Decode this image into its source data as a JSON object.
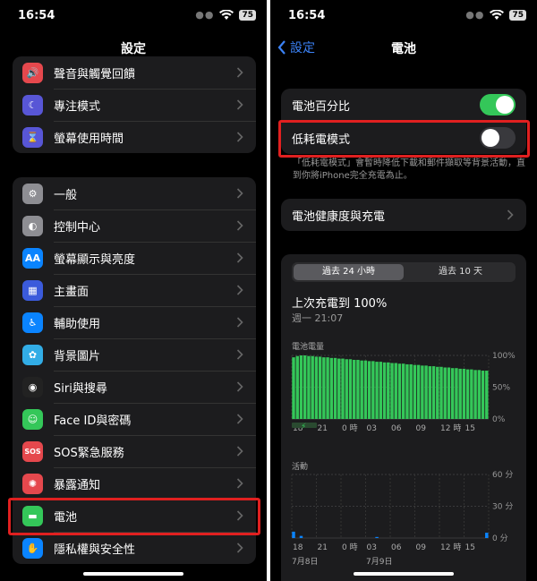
{
  "status": {
    "time": "16:54",
    "battery": "75"
  },
  "left": {
    "title": "設定",
    "group1": [
      {
        "label": "聲音與觸覺回饋",
        "icon": "speaker-icon",
        "color": "#e5484d",
        "glyph": "🔊"
      },
      {
        "label": "專注模式",
        "icon": "moon-icon",
        "color": "#5856d6",
        "glyph": "☾"
      },
      {
        "label": "螢幕使用時間",
        "icon": "hourglass-icon",
        "color": "#5856d6",
        "glyph": "⌛"
      }
    ],
    "group2": [
      {
        "label": "一般",
        "icon": "gear-icon",
        "color": "#8e8e93",
        "glyph": "⚙"
      },
      {
        "label": "控制中心",
        "icon": "switches-icon",
        "color": "#8e8e93",
        "glyph": "◐"
      },
      {
        "label": "螢幕顯示與亮度",
        "icon": "text-size-icon",
        "color": "#0a84ff",
        "glyph": "AA"
      },
      {
        "label": "主畫面",
        "icon": "grid-icon",
        "color": "#3b5bdb",
        "glyph": "▦"
      },
      {
        "label": "輔助使用",
        "icon": "accessibility-icon",
        "color": "#0a84ff",
        "glyph": "♿"
      },
      {
        "label": "背景圖片",
        "icon": "flower-icon",
        "color": "#32ade6",
        "glyph": "✿"
      },
      {
        "label": "Siri與搜尋",
        "icon": "siri-icon",
        "color": "#222",
        "glyph": "◉"
      },
      {
        "label": "Face ID與密碼",
        "icon": "face-id-icon",
        "color": "#34c759",
        "glyph": "☺"
      },
      {
        "label": "SOS緊急服務",
        "icon": "sos-icon",
        "color": "#e5484d",
        "glyph": "SOS"
      },
      {
        "label": "暴露通知",
        "icon": "exposure-icon",
        "color": "#e5484d",
        "glyph": "✺"
      },
      {
        "label": "電池",
        "icon": "battery-icon",
        "color": "#34c759",
        "glyph": "▬"
      },
      {
        "label": "隱私權與安全性",
        "icon": "hand-icon",
        "color": "#0a84ff",
        "glyph": "✋"
      }
    ]
  },
  "right": {
    "back_label": "設定",
    "title": "電池",
    "battery_percentage_label": "電池百分比",
    "low_power_label": "低耗電模式",
    "low_power_footer": "「低耗電模式」會暫時降低下載和郵件擷取等背景活動，直到你將iPhone完全充電為止。",
    "health_label": "電池健康度與充電",
    "seg_24h": "過去 24 小時",
    "seg_10d": "過去 10 天",
    "last_charged": "上次充電到 100%",
    "last_charged_time": "週一 21:07",
    "level_title": "電池電量",
    "level_ticks": [
      "100%",
      "50%",
      "0%"
    ],
    "activity_title": "活動",
    "activity_ticks": [
      "60 分",
      "30 分",
      "0 分"
    ],
    "x_ticks": [
      "18",
      "21",
      "0 時",
      "03",
      "06",
      "09",
      "12 時",
      "15"
    ],
    "date_left": "7月8日",
    "date_right": "7月9日",
    "accent_green": "#34c759",
    "toggle_off": "#39393d"
  },
  "chart_data": [
    {
      "type": "bar",
      "title": "電池電量",
      "x": [
        "18",
        "21",
        "0 時",
        "03",
        "06",
        "09",
        "12 時",
        "15"
      ],
      "values": [
        97,
        99,
        100,
        100,
        99,
        99,
        98,
        98,
        97,
        97,
        96,
        96,
        95,
        95,
        94,
        94,
        93,
        93,
        92,
        92,
        91,
        91,
        90,
        90,
        89,
        89,
        88,
        88,
        87,
        87,
        86,
        86,
        85,
        85,
        84,
        84,
        83,
        83,
        82,
        82,
        81,
        81,
        80,
        80,
        79,
        79,
        78,
        78,
        77,
        77,
        76,
        76
      ],
      "ylim": [
        0,
        100
      ]
    },
    {
      "type": "bar",
      "title": "活動",
      "x": [
        "18",
        "21",
        "0 時",
        "03",
        "06",
        "09",
        "12 時",
        "15"
      ],
      "values": [
        6,
        0,
        2,
        0,
        0,
        0,
        0,
        0,
        0,
        0,
        0,
        0,
        0,
        0,
        0,
        0,
        0,
        0,
        0,
        0,
        0,
        0,
        1,
        0,
        0,
        0,
        0,
        0,
        0,
        0,
        0,
        0,
        0,
        0,
        0,
        0,
        0,
        0,
        0,
        0,
        0,
        0,
        0,
        0,
        0,
        0,
        0,
        0,
        0,
        0,
        0,
        5
      ],
      "ylim": [
        0,
        60
      ]
    }
  ]
}
